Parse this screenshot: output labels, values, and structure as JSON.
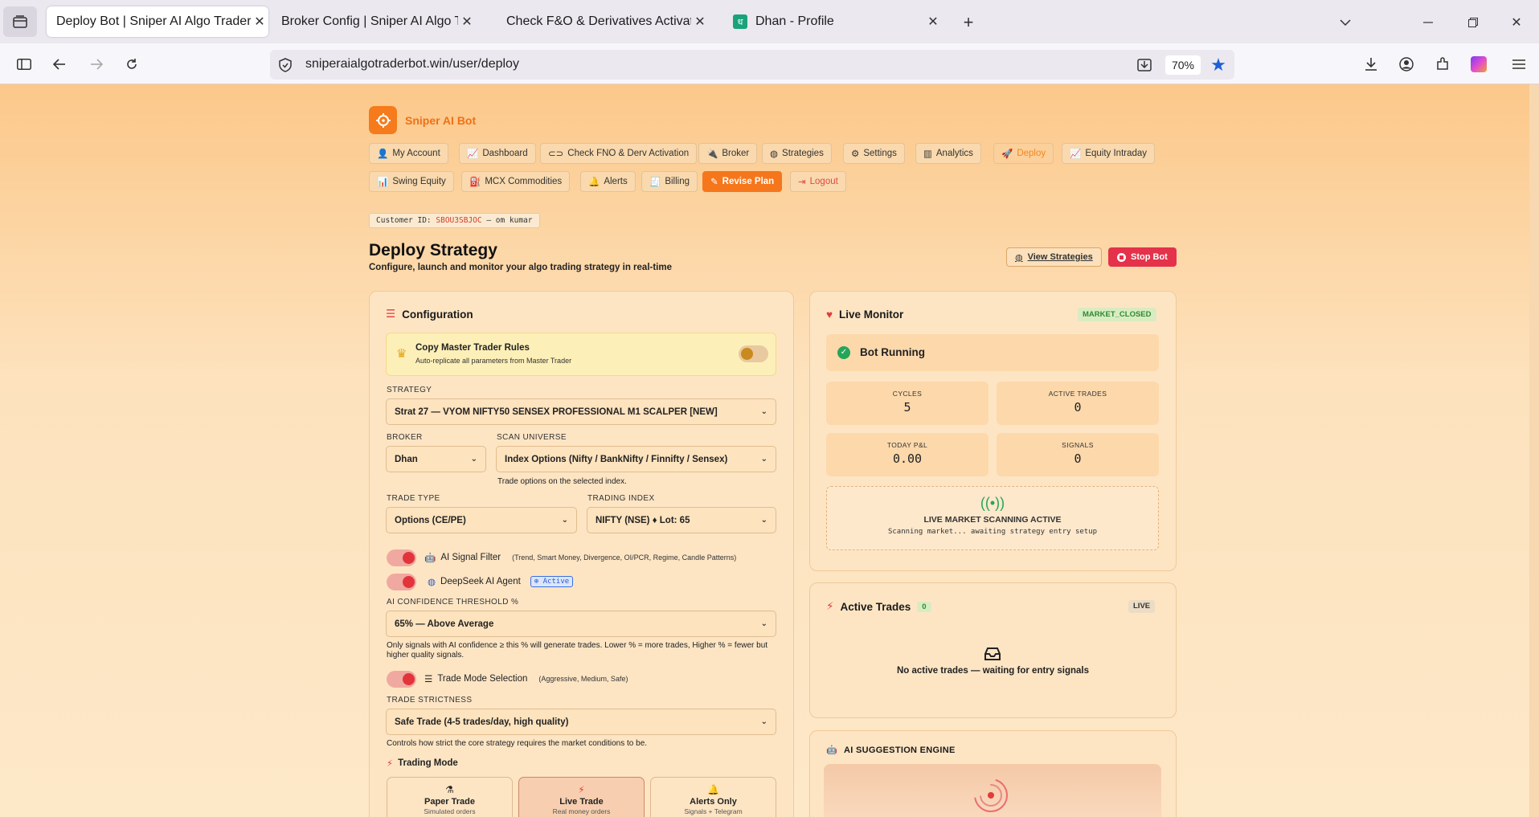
{
  "browser": {
    "tabs": [
      {
        "title": "Deploy Bot | Sniper AI Algo Trader Bot",
        "active": true
      },
      {
        "title": "Broker Config | Sniper AI Algo Trader Bot"
      },
      {
        "title": "Check F&O & Derivatives Activation"
      },
      {
        "title": "Dhan - Profile"
      }
    ],
    "url": "sniperaialgotraderbot.win/user/deploy",
    "zoom": "70%"
  },
  "brand": {
    "name": "Sniper AI Bot",
    "accent": "#f57b1c"
  },
  "nav": {
    "row1": [
      "My Account",
      "Dashboard",
      "Check FNO & Derv Activation",
      "Broker",
      "Strategies",
      "Settings",
      "Analytics",
      "Deploy",
      "Equity Intraday"
    ],
    "row2": [
      "Swing Equity",
      "MCX Commodities",
      "Alerts",
      "Billing",
      "Revise Plan",
      "Logout"
    ]
  },
  "customer": {
    "label": "Customer ID:",
    "id": "SBOU3SBJOC",
    "name": "— om kumar"
  },
  "header": {
    "title": "Deploy Strategy",
    "subtitle": "Configure, launch and monitor your algo trading strategy in real-time",
    "view_strategies": "View Strategies",
    "stop_bot": "Stop Bot"
  },
  "config": {
    "title": "Configuration",
    "copy_master": {
      "title": "Copy Master Trader Rules",
      "desc": "Auto-replicate all parameters from Master Trader"
    },
    "strategy_label": "STRATEGY",
    "strategy_value": "Strat 27 — VYOM NIFTY50 SENSEX PROFESSIONAL M1 SCALPER [NEW]",
    "broker_label": "BROKER",
    "broker_value": "Dhan",
    "scan_label": "SCAN UNIVERSE",
    "scan_value": "Index Options (Nifty / BankNifty / Finnifty / Sensex)",
    "scan_help": "Trade options on the selected index.",
    "trade_type_label": "TRADE TYPE",
    "trade_type_value": "Options (CE/PE)",
    "trading_index_label": "TRADING INDEX",
    "trading_index_value": "NIFTY (NSE) ♦ Lot: 65",
    "ai_filter": {
      "label": "AI Signal Filter",
      "hint": "(Trend, Smart Money, Divergence, OI/PCR, Regime, Candle Patterns)"
    },
    "deepseek": {
      "label": "DeepSeek AI Agent",
      "badge": "Active"
    },
    "confidence_label": "AI CONFIDENCE THRESHOLD %",
    "confidence_value": "65% — Above Average",
    "confidence_help": "Only signals with AI confidence ≥ this % will generate trades. Lower % = more trades, Higher % = fewer but higher quality signals.",
    "trade_mode": {
      "label": "Trade Mode Selection",
      "hint": "(Aggressive, Medium, Safe)"
    },
    "strictness_label": "TRADE STRICTNESS",
    "strictness_value": "Safe Trade (4-5 trades/day, high quality)",
    "strictness_help": "Controls how strict the core strategy requires the market conditions to be.",
    "trading_mode_title": "Trading Mode",
    "modes": [
      {
        "title": "Paper Trade",
        "sub": "Simulated orders"
      },
      {
        "title": "Live Trade",
        "sub": "Real money orders"
      },
      {
        "title": "Alerts Only",
        "sub": "Signals + Telegram"
      }
    ]
  },
  "monitor": {
    "title": "Live Monitor",
    "status_badge": "MARKET_CLOSED",
    "bot_status": "Bot Running",
    "stats": [
      {
        "label": "CYCLES",
        "value": "5"
      },
      {
        "label": "ACTIVE TRADES",
        "value": "0"
      },
      {
        "label": "TODAY P&L",
        "value": "0.00"
      },
      {
        "label": "SIGNALS",
        "value": "0"
      }
    ],
    "scan_title": "LIVE MARKET SCANNING ACTIVE",
    "scan_sub": "Scanning market... awaiting strategy entry setup"
  },
  "active_trades": {
    "title": "Active Trades",
    "count": "0",
    "badge": "LIVE",
    "empty": "No active trades — waiting for entry signals"
  },
  "ai_engine": {
    "title": "AI SUGGESTION ENGINE"
  }
}
